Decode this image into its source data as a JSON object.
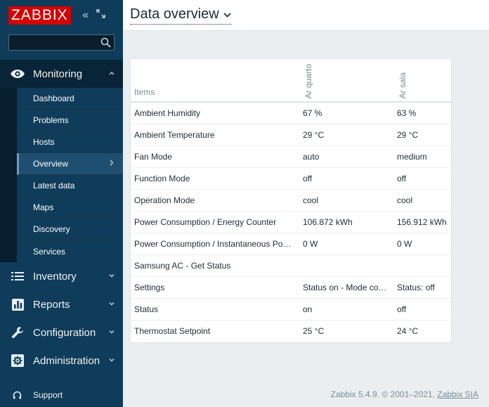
{
  "app": {
    "logo_text": "ZABBIX"
  },
  "search": {
    "value": "",
    "placeholder": ""
  },
  "sidebar": {
    "monitoring": {
      "label": "Monitoring",
      "items": [
        {
          "label": "Dashboard"
        },
        {
          "label": "Problems"
        },
        {
          "label": "Hosts"
        },
        {
          "label": "Overview"
        },
        {
          "label": "Latest data"
        },
        {
          "label": "Maps"
        },
        {
          "label": "Discovery"
        },
        {
          "label": "Services"
        }
      ]
    },
    "inventory": {
      "label": "Inventory"
    },
    "reports": {
      "label": "Reports"
    },
    "configuration": {
      "label": "Configuration"
    },
    "administration": {
      "label": "Administration"
    },
    "support": {
      "label": "Support"
    }
  },
  "header": {
    "title": "Data overview"
  },
  "table": {
    "columns": [
      "Items",
      "Ar quarto",
      "Ar sala"
    ],
    "rows": [
      [
        "Ambient Humidity",
        "67 %",
        "63 %"
      ],
      [
        "Ambient Temperature",
        "29 °C",
        "29 °C"
      ],
      [
        "Fan Mode",
        "auto",
        "medium"
      ],
      [
        "Function Mode",
        "off",
        "off"
      ],
      [
        "Operation Mode",
        "cool",
        "cool"
      ],
      [
        "Power Consumption / Energy Counter",
        "106.872 kWh",
        "156.912 kWh"
      ],
      [
        "Power Consumption / Instantaneous Power",
        "0 W",
        "0 W"
      ],
      [
        "Samsung AC - Get Status",
        "",
        ""
      ],
      [
        "Settings",
        "Status on - Mode coo...",
        "Status: off"
      ],
      [
        "Status",
        "on",
        "off"
      ],
      [
        "Thermostat Setpoint",
        "25 °C",
        "24 °C"
      ]
    ]
  },
  "footer": {
    "text": "Zabbix 5.4.9. © 2001–2021,",
    "link": "Zabbix SIA"
  },
  "colors": {
    "sidebar_bg": "#0f3c5a",
    "logo_red": "#d40000",
    "page_bg": "#ebeef0"
  }
}
